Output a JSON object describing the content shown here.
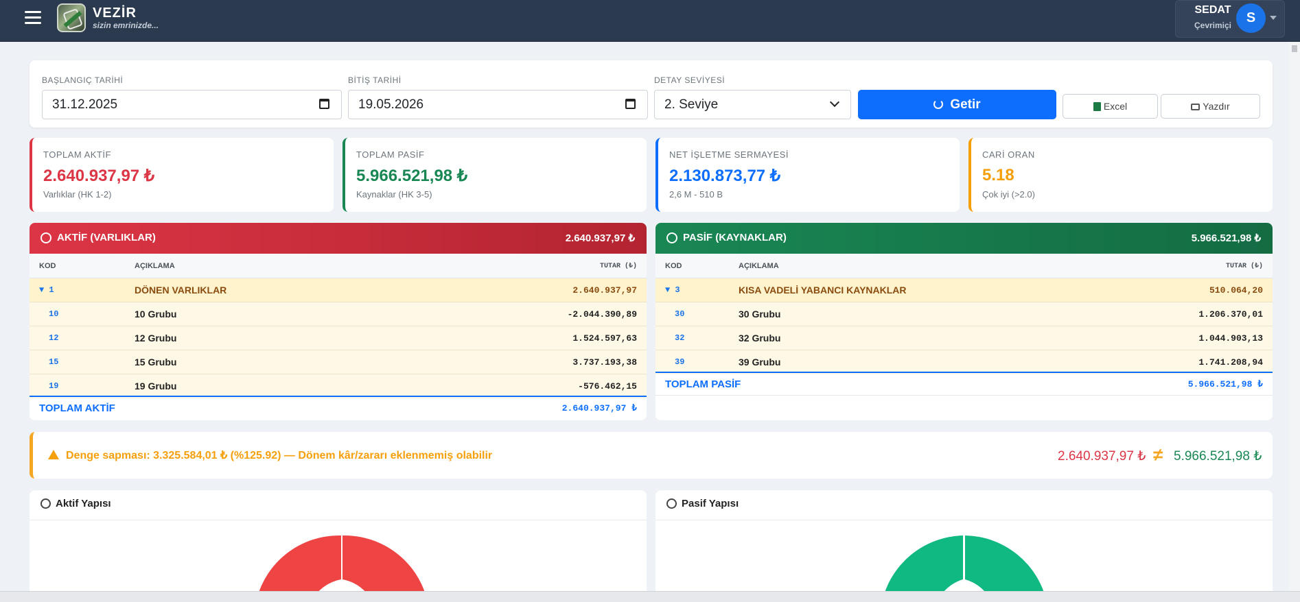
{
  "app": {
    "brand": "VEZİR",
    "slogan": "sizin emrinizde..."
  },
  "user": {
    "name": "SEDAT",
    "status": "Çevrimiçi",
    "initial": "S"
  },
  "filters": {
    "start_label": "BAŞLANGIÇ TARİHİ",
    "start_value": "31.12.2025",
    "end_label": "BİTİŞ TARİHİ",
    "end_value": "19.05.2026",
    "level_label": "DETAY SEVİYESİ",
    "level_value": "2. Seviye",
    "fetch_label": "Getir",
    "excel_label": "Excel",
    "print_label": "Yazdır"
  },
  "stats": [
    {
      "label": "TOPLAM AKTİF",
      "value": "2.640.937,97 ₺",
      "sub": "Varlıklar (HK 1-2)",
      "color": "#dc3545"
    },
    {
      "label": "TOPLAM PASİF",
      "value": "5.966.521,98 ₺",
      "sub": "Kaynaklar (HK 3-5)",
      "color": "#198754"
    },
    {
      "label": "NET İŞLETME SERMAYESİ",
      "value": "2.130.873,77 ₺",
      "sub": "2,6 M - 510 B",
      "color": "#0d6efd"
    },
    {
      "label": "CARİ ORAN",
      "value": "5.18",
      "sub": "Çok iyi (>2.0)",
      "color": "#f59f0b"
    }
  ],
  "aktif": {
    "title": "AKTİF (VARLIKLAR)",
    "total": "2.640.937,97 ₺",
    "headers": {
      "kod": "KOD",
      "aciklama": "AÇIKLAMA",
      "tutar": "TUTAR (₺)"
    },
    "rows": [
      {
        "kod": "▼ 1",
        "aciklama": "DÖNEN VARLIKLAR",
        "tutar": "2.640.937,97"
      },
      {
        "kod": "10",
        "aciklama": "10 Grubu",
        "tutar": "-2.044.390,89"
      },
      {
        "kod": "12",
        "aciklama": "12 Grubu",
        "tutar": "1.524.597,63"
      },
      {
        "kod": "15",
        "aciklama": "15 Grubu",
        "tutar": "3.737.193,38"
      },
      {
        "kod": "19",
        "aciklama": "19 Grubu",
        "tutar": "-576.462,15"
      }
    ],
    "total_label": "TOPLAM AKTİF",
    "total_value": "2.640.937,97 ₺"
  },
  "pasif": {
    "title": "PASİF (KAYNAKLAR)",
    "total": "5.966.521,98 ₺",
    "headers": {
      "kod": "KOD",
      "aciklama": "AÇIKLAMA",
      "tutar": "TUTAR (₺)"
    },
    "rows": [
      {
        "kod": "▼ 3",
        "aciklama": "KISA VADELİ YABANCI KAYNAKLAR",
        "tutar": "510.064,20"
      },
      {
        "kod": "30",
        "aciklama": "30 Grubu",
        "tutar": "1.206.370,01"
      },
      {
        "kod": "32",
        "aciklama": "32 Grubu",
        "tutar": "1.044.903,13"
      },
      {
        "kod": "39",
        "aciklama": "39 Grubu",
        "tutar": "1.741.208,94"
      }
    ],
    "total_label": "TOPLAM PASİF",
    "total_value": "5.966.521,98 ₺"
  },
  "warning": {
    "text": "Denge sapması: 3.325.584,01 ₺ (%125.92) — Dönem kâr/zararı eklenmemiş olabilir",
    "aktif": "2.640.937,97 ₺",
    "neq": "≠",
    "pasif": "5.966.521,98 ₺"
  },
  "charts": {
    "aktif_title": "Aktif Yapısı",
    "pasif_title": "Pasif Yapısı"
  },
  "colors": {
    "aktif": "#ef4444",
    "pasif": "#10b981",
    "accent": "#0d6efd"
  }
}
